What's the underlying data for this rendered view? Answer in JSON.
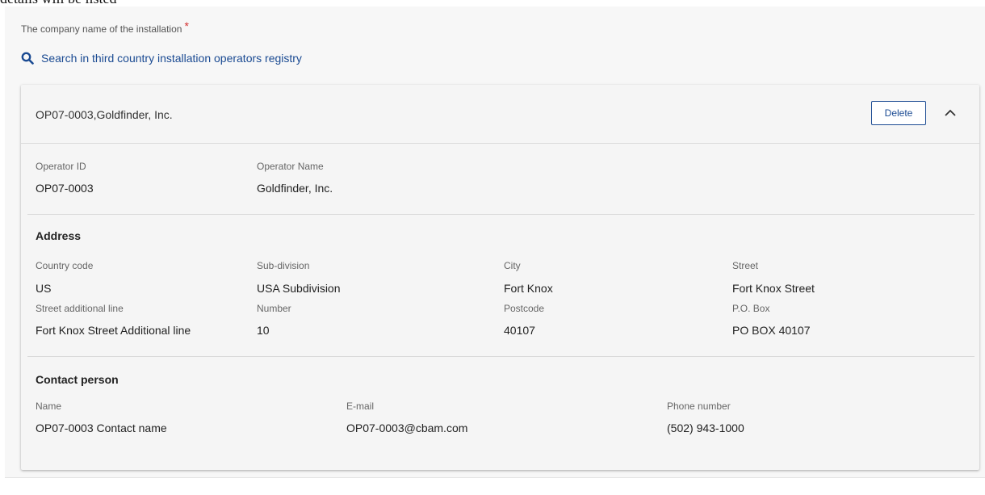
{
  "cutoff_text": "details will be listed",
  "field": {
    "label": "The company name of the installation",
    "required_mark": "*"
  },
  "search": {
    "icon": "search-icon",
    "link_label": "Search in third country installation operators registry"
  },
  "operator_card": {
    "title": "OP07-0003,Goldfinder, Inc.",
    "delete_label": "Delete",
    "collapse_icon": "chevron-up-icon",
    "operator": {
      "id_label": "Operator ID",
      "id_value": "OP07-0003",
      "name_label": "Operator Name",
      "name_value": "Goldfinder, Inc."
    },
    "address": {
      "title": "Address",
      "country_code_label": "Country code",
      "country_code_value": "US",
      "subdivision_label": "Sub-division",
      "subdivision_value": "USA Subdivision",
      "city_label": "City",
      "city_value": "Fort Knox",
      "street_label": "Street",
      "street_value": "Fort Knox Street",
      "street_additional_label": "Street additional line",
      "street_additional_value": "Fort Knox Street Additional line",
      "number_label": "Number",
      "number_value": "10",
      "postcode_label": "Postcode",
      "postcode_value": "40107",
      "po_box_label": "P.O. Box",
      "po_box_value": "PO BOX 40107"
    },
    "contact": {
      "title": "Contact person",
      "name_label": "Name",
      "name_value": "OP07-0003 Contact name",
      "email_label": "E-mail",
      "email_value": "OP07-0003@cbam.com",
      "phone_label": "Phone number",
      "phone_value": "(502) 943-1000"
    }
  },
  "colors": {
    "link": "#1a4a92",
    "required": "#d32f2f",
    "panel_bg": "#f7f7f7"
  }
}
